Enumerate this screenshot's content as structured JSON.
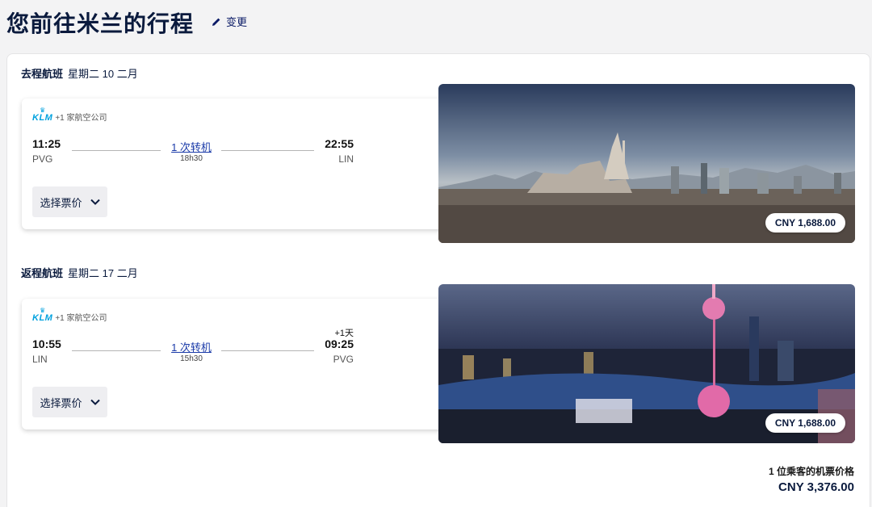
{
  "header": {
    "title": "您前往米兰的行程",
    "change_label": "变更"
  },
  "outbound": {
    "label": "去程航班",
    "date": "星期二 10 二月",
    "airline_logo": "KLM",
    "airline_extra": "+1 家航空公司",
    "dep_time": "11:25",
    "dep_code": "PVG",
    "stops": "1 次转机",
    "duration": "18h30",
    "arr_time": "22:55",
    "arr_code": "LIN",
    "fare_button": "选择票价",
    "price": "CNY 1,688.00",
    "photo_icon": "milan-skyline-photo"
  },
  "return": {
    "label": "返程航班",
    "date": "星期二 17 二月",
    "airline_logo": "KLM",
    "airline_extra": "+1 家航空公司",
    "dep_time": "10:55",
    "dep_code": "LIN",
    "stops": "1 次转机",
    "duration": "15h30",
    "next_day": "+1天",
    "arr_time": "09:25",
    "arr_code": "PVG",
    "fare_button": "选择票价",
    "price": "CNY 1,688.00",
    "photo_icon": "shanghai-skyline-photo"
  },
  "summary": {
    "label": "1 位乘客的机票价格",
    "total": "CNY 3,376.00"
  },
  "colors": {
    "brand_navy": "#0a1a3d",
    "link_blue": "#1a3aa8",
    "klm_blue": "#00a1de"
  }
}
